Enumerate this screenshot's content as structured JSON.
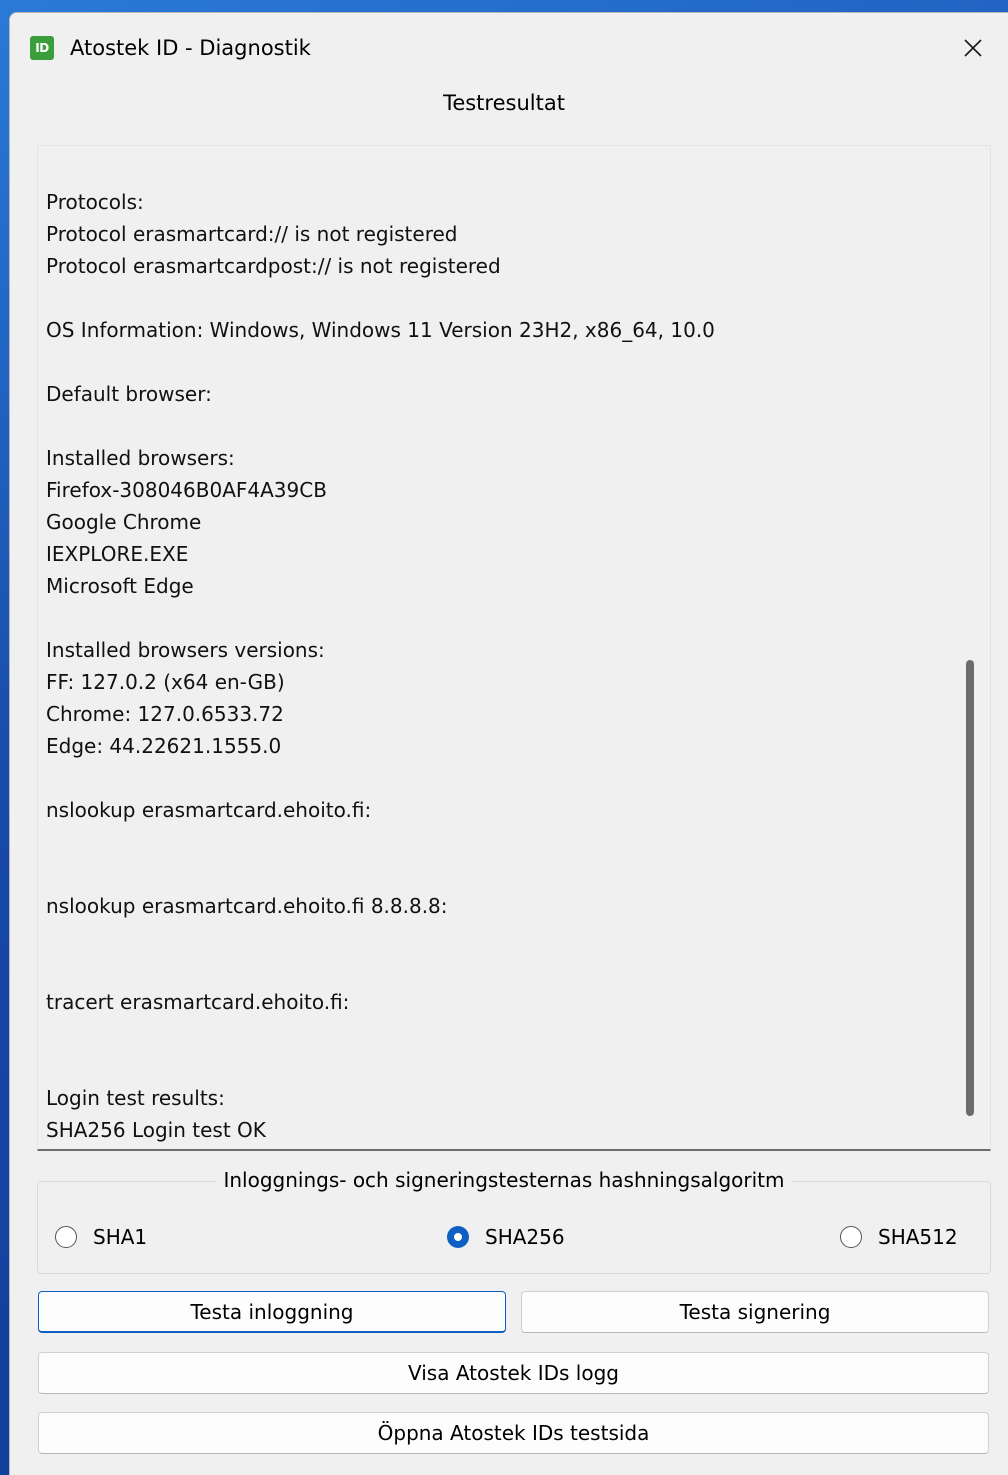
{
  "window": {
    "title": "Atostek ID - Diagnostik",
    "icon_text": "ID",
    "accent_color": "#0e5fc1",
    "icon_color": "#3a9e3a"
  },
  "results": {
    "title": "Testresultat",
    "lines": [
      "Protocols:",
      "Protocol erasmartcard:// is not registered",
      "Protocol erasmartcardpost:// is not registered",
      "",
      "OS Information: Windows, Windows 11 Version 23H2, x86_64, 10.0",
      "",
      "Default browser:",
      "",
      "Installed browsers:",
      "Firefox-308046B0AF4A39CB",
      "Google Chrome",
      "IEXPLORE.EXE",
      "Microsoft Edge",
      "",
      "Installed browsers versions:",
      "FF: 127.0.2 (x64 en-GB)",
      "Chrome: 127.0.6533.72",
      "Edge: 44.22621.1555.0",
      "",
      "nslookup erasmartcard.ehoito.fi:",
      "",
      "",
      "nslookup erasmartcard.ehoito.fi 8.8.8.8:",
      "",
      "",
      "tracert erasmartcard.ehoito.fi:",
      "",
      "",
      "Login test results:",
      "SHA256 Login test OK"
    ]
  },
  "hash": {
    "legend": "Inloggnings- och signeringstesternas hashningsalgoritm",
    "options": [
      {
        "label": "SHA1",
        "checked": false
      },
      {
        "label": "SHA256",
        "checked": true
      },
      {
        "label": "SHA512",
        "checked": false
      }
    ]
  },
  "buttons": {
    "test_login": "Testa inloggning",
    "test_sign": "Testa signering",
    "show_log": "Visa Atostek IDs logg",
    "open_testpage": "Öppna Atostek IDs testsida"
  }
}
